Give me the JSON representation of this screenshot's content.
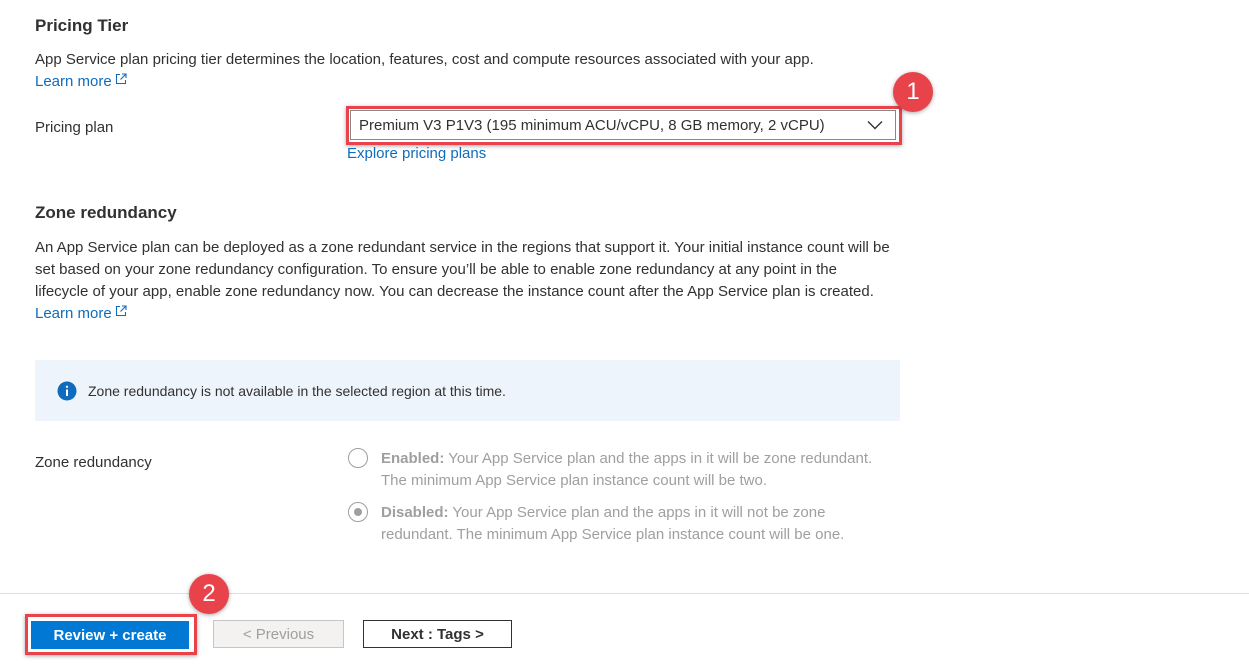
{
  "pricing": {
    "heading": "Pricing Tier",
    "description": "App Service plan pricing tier determines the location, features, cost and compute resources associated with your app.",
    "learn_more": "Learn more",
    "plan_label": "Pricing plan",
    "plan_value": "Premium V3 P1V3 (195 minimum ACU/vCPU, 8 GB memory, 2 vCPU)",
    "explore_link": "Explore pricing plans"
  },
  "zone": {
    "heading": "Zone redundancy",
    "description": "An App Service plan can be deployed as a zone redundant service in the regions that support it. Your initial instance count will be set based on your zone redundancy configuration. To ensure you’ll be able to enable zone redundancy at any point in the lifecycle of your app, enable zone redundancy now. You can decrease the instance count after the App Service plan is created.",
    "learn_more": "Learn more",
    "info_text": "Zone redundancy is not available in the selected region at this time.",
    "field_label": "Zone redundancy",
    "options": [
      {
        "title": "Enabled:",
        "text": "Your App Service plan and the apps in it will be zone redundant. The minimum App Service plan instance count will be two.",
        "selected": false
      },
      {
        "title": "Disabled:",
        "text": "Your App Service plan and the apps in it will not be zone redundant. The minimum App Service plan instance count will be one.",
        "selected": true
      }
    ]
  },
  "footer": {
    "review_create": "Review + create",
    "previous": "< Previous",
    "next": "Next : Tags >"
  },
  "annotations": {
    "badge1": "1",
    "badge2": "2"
  },
  "colors": {
    "accent": "#0078d4",
    "link": "#0f6cbd",
    "highlight": "#e8434b",
    "info_bg": "#eef4fc"
  },
  "icons": [
    "external-link-icon",
    "chevron-down-icon",
    "info-icon"
  ]
}
